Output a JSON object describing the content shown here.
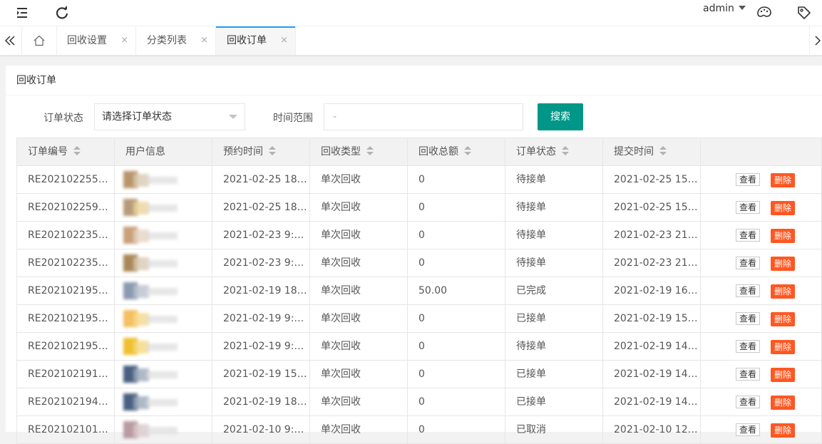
{
  "header": {
    "menu_icon": "menu-fold-icon",
    "refresh_icon": "refresh-icon",
    "user": "admin",
    "theme_icon": "palette-icon",
    "tag_icon": "tag-icon"
  },
  "tabs": {
    "home_icon": "home-icon",
    "items": [
      {
        "label": "回收设置",
        "close": "×"
      },
      {
        "label": "分类列表",
        "close": "×"
      },
      {
        "label": "回收订单",
        "close": "×"
      }
    ]
  },
  "card": {
    "title": "回收订单"
  },
  "filters": {
    "status_label": "订单状态",
    "status_value": "请选择订单状态",
    "time_label": "时间范围",
    "time_value": "-",
    "search_label": "搜索"
  },
  "table": {
    "columns": [
      "订单编号",
      "用户信息",
      "预约时间",
      "回收类型",
      "回收总额",
      "订单状态",
      "提交时间",
      ""
    ],
    "view_label": "查看",
    "delete_label": "删除",
    "rows": [
      {
        "order_no": "RE202102255…",
        "user": "",
        "appoint_time": "2021-02-25 18…",
        "type": "单次回收",
        "amount": "0",
        "status": "待接单",
        "submit_time": "2021-02-25 15…",
        "avatar_colors": [
          "#b8956a",
          "#d9cbb0"
        ]
      },
      {
        "order_no": "RE202102259…",
        "user": "",
        "appoint_time": "2021-02-25 18…",
        "type": "单次回收",
        "amount": "0",
        "status": "待接单",
        "submit_time": "2021-02-25 15…",
        "avatar_colors": [
          "#b89a7a",
          "#e8d59a"
        ]
      },
      {
        "order_no": "RE202102235…",
        "user": "",
        "appoint_time": "2021-02-23 9:…",
        "type": "单次回收",
        "amount": "0",
        "status": "待接单",
        "submit_time": "2021-02-23 21…",
        "avatar_colors": [
          "#c8a07a",
          "#e6d3c0"
        ]
      },
      {
        "order_no": "RE202102235…",
        "user": "",
        "appoint_time": "2021-02-23 9:…",
        "type": "单次回收",
        "amount": "0",
        "status": "待接单",
        "submit_time": "2021-02-23 21…",
        "avatar_colors": [
          "#a88858",
          "#d8c8b0"
        ]
      },
      {
        "order_no": "RE202102195…",
        "user": "",
        "appoint_time": "2021-02-19 18…",
        "type": "单次回收",
        "amount": "50.00",
        "status": "已完成",
        "submit_time": "2021-02-19 16…",
        "avatar_colors": [
          "#8a9ab0",
          "#b8c0cc"
        ]
      },
      {
        "order_no": "RE202102195…",
        "user": "",
        "appoint_time": "2021-02-19 9:…",
        "type": "单次回收",
        "amount": "0",
        "status": "已接单",
        "submit_time": "2021-02-19 15…",
        "avatar_colors": [
          "#f4c060",
          "#f6d88a"
        ]
      },
      {
        "order_no": "RE202102195…",
        "user": "",
        "appoint_time": "2021-02-19 9:…",
        "type": "单次回收",
        "amount": "0",
        "status": "待接单",
        "submit_time": "2021-02-19 14…",
        "avatar_colors": [
          "#f0c030",
          "#f4d880"
        ]
      },
      {
        "order_no": "RE202102191…",
        "user": "",
        "appoint_time": "2021-02-19 15…",
        "type": "单次回收",
        "amount": "0",
        "status": "已接单",
        "submit_time": "2021-02-19 14…",
        "avatar_colors": [
          "#4a6080",
          "#9aa8b8"
        ]
      },
      {
        "order_no": "RE202102194…",
        "user": "",
        "appoint_time": "2021-02-19 18…",
        "type": "单次回收",
        "amount": "0",
        "status": "已接单",
        "submit_time": "2021-02-19 14…",
        "avatar_colors": [
          "#4a6080",
          "#9aa8b8"
        ]
      },
      {
        "order_no": "RE202102101…",
        "user": "",
        "appoint_time": "2021-02-10 9:…",
        "type": "单次回收",
        "amount": "0",
        "status": "已取消",
        "submit_time": "2021-02-10 12…",
        "avatar_colors": [
          "#b89aa0",
          "#d8c8c8"
        ]
      }
    ]
  },
  "colors": {
    "primary": "#009688",
    "danger": "#ff5722",
    "tab_accent": "#1e9fff"
  }
}
